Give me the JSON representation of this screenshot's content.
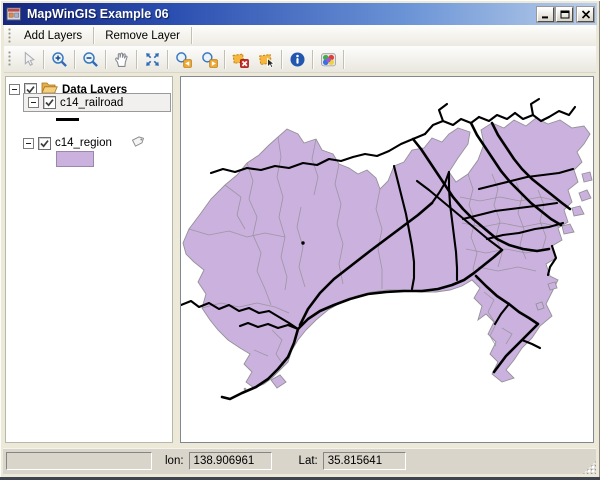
{
  "window": {
    "title": "MapWinGIS Example 06"
  },
  "window_controls": {
    "icons": [
      "minimize-icon",
      "maximize-icon",
      "close-icon"
    ]
  },
  "menubar": {
    "items": [
      "Add Layers",
      "Remove Layer"
    ]
  },
  "toolbar": {
    "buttons": [
      "pointer",
      "zoom-in",
      "zoom-out",
      "pan",
      "zoom-extent",
      "zoom-previous",
      "zoom-next",
      "clear-selection",
      "select-shape",
      "identify-info",
      "symbology-palette"
    ],
    "disabled": [
      "pointer"
    ]
  },
  "legend": {
    "root": {
      "label": "Data Layers",
      "checked": true,
      "expanded": true,
      "icon": "open-folder-icon"
    },
    "layers": [
      {
        "label": "c14_railroad",
        "checked": true,
        "expanded": true,
        "selected": true,
        "symbol": "line",
        "symbol_color": "#000000"
      },
      {
        "label": "c14_region",
        "checked": true,
        "expanded": true,
        "selected": false,
        "symbol": "fill",
        "symbol_color": "#CBB1DD",
        "tag_icon": true
      }
    ]
  },
  "map": {
    "description": "Kanagawa prefecture regions (purple) with railroad network (black)"
  },
  "statusbar": {
    "lon_label": "lon:",
    "lon_value": "138.906961",
    "lat_label": "Lat:",
    "lat_value": "35.815641"
  },
  "colors": {
    "region_fill": "#CBB1DD",
    "region_border": "#94919A",
    "railroad": "#000000",
    "map_bg": "#FFFFFF",
    "chrome": "#ECE9D8",
    "statusbar_bg": "#D9D5CB",
    "titlebar_left": "#16277E",
    "titlebar_right": "#BBCFEA",
    "legend_selection_bg": "#F1F0EE"
  }
}
